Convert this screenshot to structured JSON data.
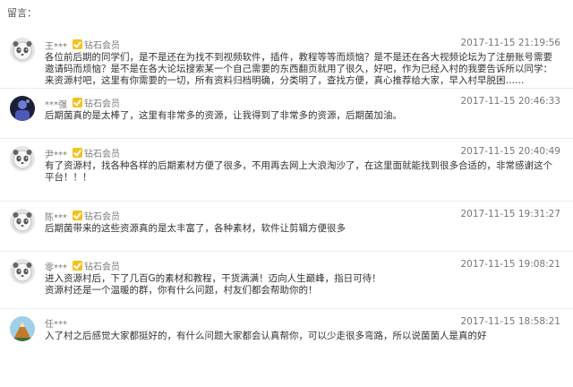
{
  "heading": "留言：",
  "badge_label": "钻石会员",
  "comments": [
    {
      "name": "王***",
      "has_badge": true,
      "time": "2017-11-15 21:19:56",
      "text": "各位前后期的同学们，是不是还在为找不到视频软件，插件，教程等等而烦恼？是不是还在各大视频论坛为了注册账号需要邀请码而烦恼？是不是在各大论坛搜索某一个自己需要的东西翻页就用了很久，好吧，作为已经入村的我要告诉所以同学：来资源村吧，这里有你需要的一切，所有资料归档明确，分类明了，查找方便，真心推荐给大家，早入村早脱困……",
      "avatar": "panda-icon"
    },
    {
      "name": "***强",
      "has_badge": true,
      "time": "2017-11-15 20:46:33",
      "text": "后期菌真的是太棒了，这里有非常多的资源，让我得到了非常多的资源，后期菌加油。",
      "avatar": "dark-photo-avatar"
    },
    {
      "name": "尹***",
      "has_badge": true,
      "time": "2017-11-15 20:40:49",
      "text": "有了资源村，找各种各样的后期素材方便了很多，不用再去网上大浪淘沙了，在这里面就能找到很多合适的，非常感谢这个平台！！！",
      "avatar": "panda-icon"
    },
    {
      "name": "陈***",
      "has_badge": true,
      "time": "2017-11-15 19:31:27",
      "text": "后期菌带来的这些资源真的是太丰富了，各种素材，软件让剪辑方便很多",
      "avatar": "panda-icon"
    },
    {
      "name": "零***",
      "has_badge": true,
      "time": "2017-11-15 19:08:21",
      "text": "进入资源村后，下了几百G的素材和教程，干货满满！迈向人生巅峰，指日可待！\n资源村还是一个温暖的群，你有什么问题，村友们都会帮助你的！",
      "avatar": "panda-icon"
    },
    {
      "name": "任***",
      "has_badge": false,
      "time": "2017-11-15 18:58:21",
      "text": "入了村之后感觉大家都挺好的，有什么问题大家都会认真帮你，可以少走很多弯路，所以说菌菌人是真的好",
      "avatar": "mountain-photo-avatar"
    }
  ]
}
